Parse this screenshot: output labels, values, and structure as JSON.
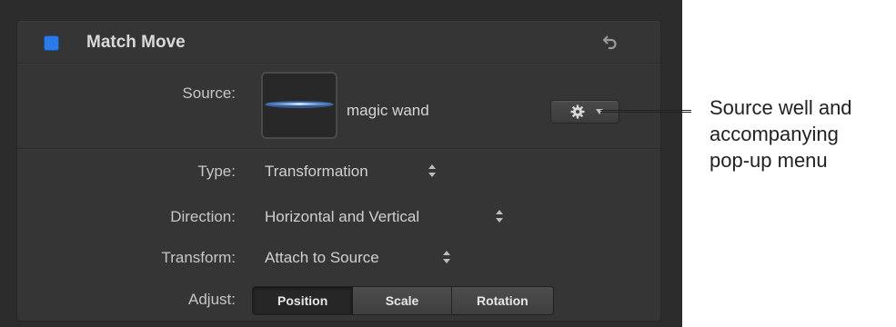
{
  "inspector": {
    "title": "Match Move",
    "enabled": true,
    "accent": "#2c7ae8",
    "icons": {
      "reset": "reset-arrow-icon",
      "gear": "gear-icon",
      "popup": "chevron-down-icon",
      "stepper": "up-down-stepper-icon"
    },
    "source": {
      "label": "Source:",
      "name": "magic wand"
    },
    "type": {
      "label": "Type:",
      "value": "Transformation"
    },
    "direction": {
      "label": "Direction:",
      "value": "Horizontal and Vertical"
    },
    "transform": {
      "label": "Transform:",
      "value": "Attach to Source"
    },
    "adjust": {
      "label": "Adjust:",
      "segments": [
        "Position",
        "Scale",
        "Rotation"
      ],
      "selected": "Position"
    }
  },
  "callout": {
    "line1": "Source well and",
    "line2": "accompanying",
    "line3": "pop-up menu"
  }
}
